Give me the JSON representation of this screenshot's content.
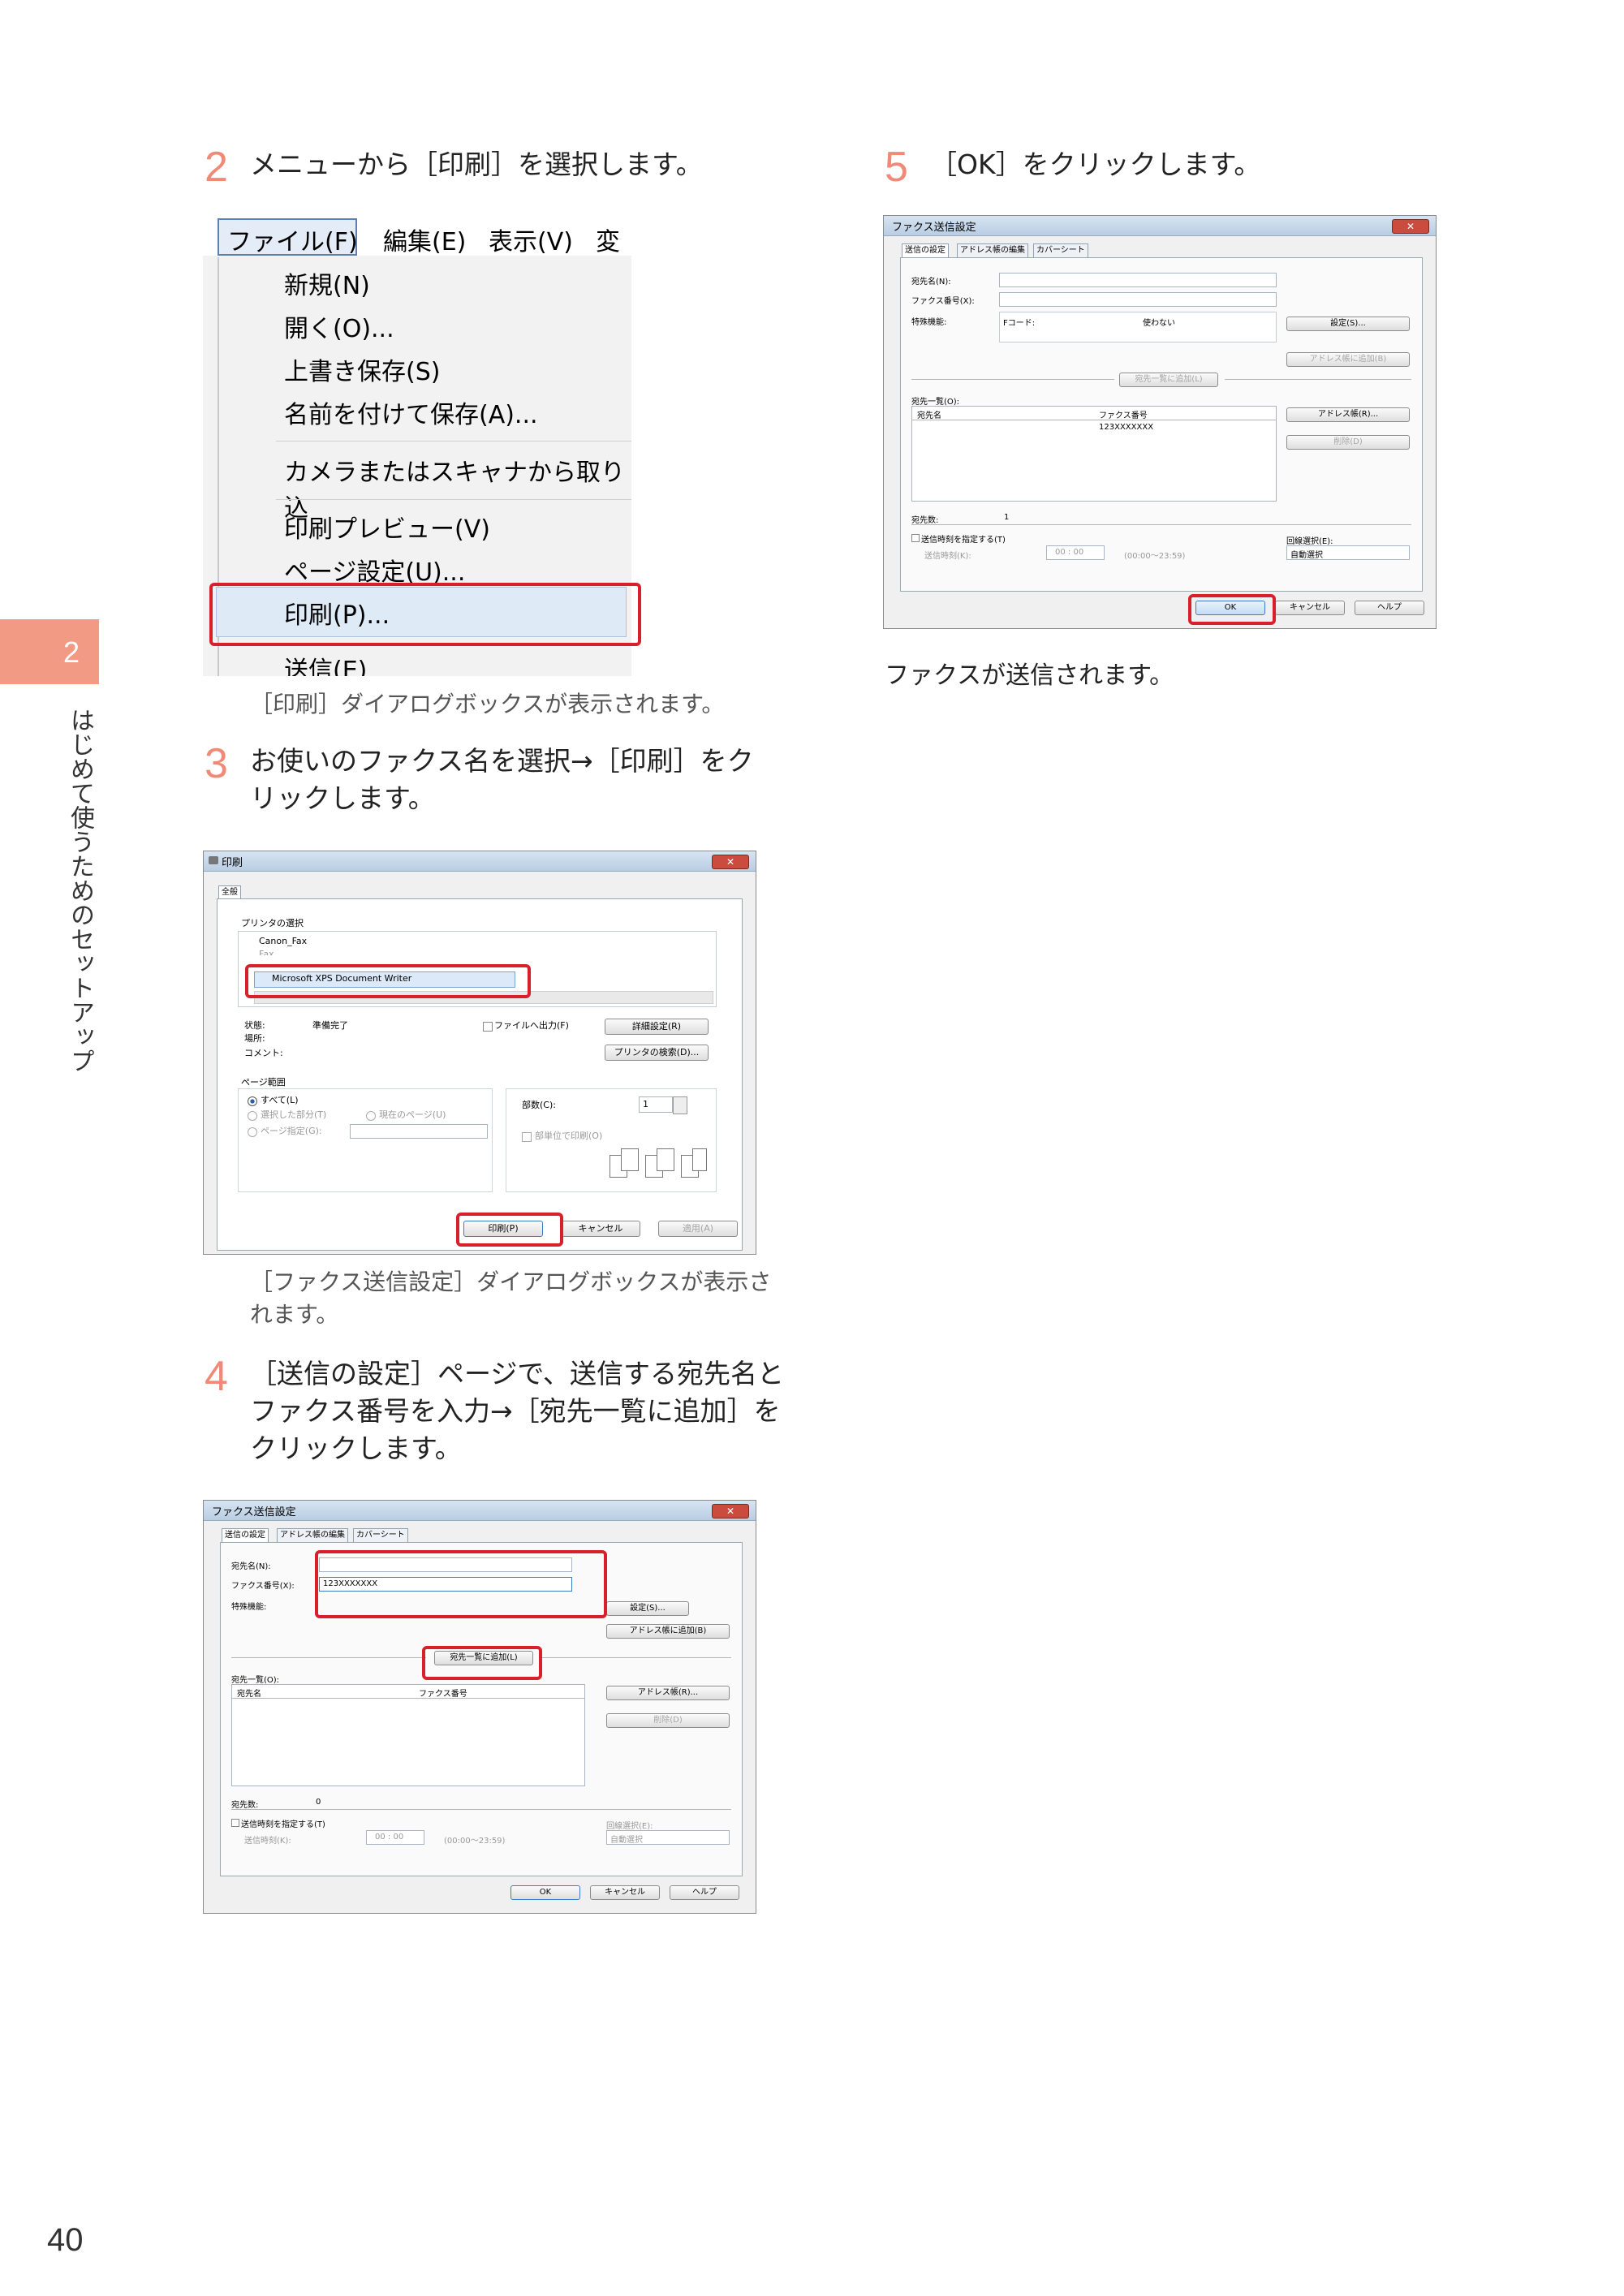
{
  "page_number": "40",
  "side_tab": {
    "number": "2",
    "label": "はじめて使うためのセットアップ"
  },
  "steps": [
    {
      "num": "2",
      "text": "メニューから［印刷］を選択します。"
    },
    {
      "num": "3",
      "text": "お使いのファクス名を選択→［印刷］をクリックします。"
    },
    {
      "num": "4",
      "text": "［送信の設定］ページで、送信する宛先名とファクス番号を入力→［宛先一覧に追加］をクリックします。"
    },
    {
      "num": "5",
      "text": "［OK］をクリックします。"
    }
  ],
  "captions": {
    "after_step2": "［印刷］ダイアログボックスが表示されます。",
    "after_step3": "［ファクス送信設定］ダイアログボックスが表示されます。",
    "after_step5": "ファクスが送信されます。"
  },
  "menu": {
    "bar": [
      "ファイル(F)",
      "編集(E)",
      "表示(V)",
      "変"
    ],
    "items": [
      "新規(N)",
      "開く(O)...",
      "上書き保存(S)",
      "名前を付けて保存(A)...",
      "カメラまたはスキャナから取り込",
      "印刷プレビュー(V)",
      "ページ設定(U)...",
      "印刷(P)...",
      "送信(E)"
    ]
  },
  "print_dialog": {
    "title": "印刷",
    "tab": "全般",
    "group_printer": "プリンタの選択",
    "printers": [
      "Canon_Fax",
      "Fax",
      "Microsoft XPS Document Writer"
    ],
    "status_label": "状態:",
    "status_value": "準備完了",
    "location_label": "場所:",
    "comment_label": "コメント:",
    "print_to_file": "ファイルへ出力(F)",
    "preferences": "詳細設定(R)",
    "find_printer": "プリンタの検索(D)...",
    "group_range": "ページ範囲",
    "range_all": "すべて(L)",
    "range_selection": "選択した部分(T)",
    "range_current": "現在のページ(U)",
    "range_pages": "ページ指定(G):",
    "copies_label": "部数(C):",
    "copies_value": "1",
    "collate": "部単位で印刷(O)",
    "btn_print": "印刷(P)",
    "btn_cancel": "キャンセル",
    "btn_apply": "適用(A)"
  },
  "fax_dialog": {
    "title": "ファクス送信設定",
    "tabs": [
      "送信の設定",
      "アドレス帳の編集",
      "カバーシート"
    ],
    "name_label": "宛先名(N):",
    "number_label": "ファクス番号(X):",
    "special_label": "特殊機能:",
    "fcode_label": "Fコード:",
    "fcode_value": "使わない",
    "btn_settings": "設定(S)...",
    "btn_add_addressbook": "アドレス帳に追加(B)",
    "btn_add_list": "宛先一覧に追加(L)",
    "list_label": "宛先一覧(O):",
    "col_name": "宛先名",
    "col_number": "ファクス番号",
    "btn_addressbook": "アドレス帳(R)...",
    "btn_delete": "削除(D)",
    "count_label": "宛先数:",
    "schedule_label": "送信時刻を指定する(T)",
    "time_label": "送信時刻(K):",
    "time_value": "00 : 00",
    "time_range": "(00:00～23:59)",
    "line_label": "回線選択(E):",
    "line_value": "自動選択",
    "btn_ok": "OK",
    "btn_cancel": "キャンセル",
    "btn_help": "ヘルプ"
  },
  "fax4": {
    "number_value": "123XXXXXXX",
    "count_value": "0"
  },
  "fax5": {
    "row_number": "123XXXXXXX",
    "count_value": "1"
  }
}
